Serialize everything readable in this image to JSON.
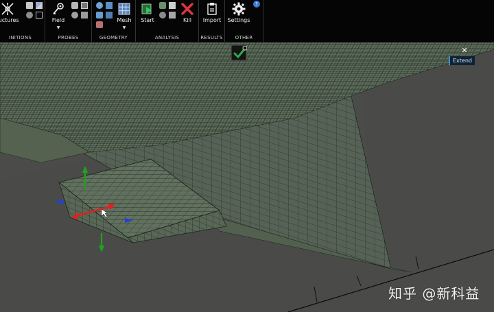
{
  "ribbon": {
    "groups": [
      {
        "label": "INITIONS",
        "buttons": [
          {
            "label": "ructures",
            "icon": "structures-icon"
          }
        ]
      },
      {
        "label": "PROBES",
        "buttons": [
          {
            "label": "Field",
            "icon": "field-probe-icon",
            "has_menu": true
          }
        ]
      },
      {
        "label": "GEOMETRY",
        "buttons": [
          {
            "label": "Mesh",
            "icon": "mesh-icon",
            "has_menu": true
          }
        ]
      },
      {
        "label": "ANALYSIS",
        "buttons": [
          {
            "label": "Start",
            "icon": "start-icon"
          },
          {
            "label": "Kill",
            "icon": "kill-icon"
          }
        ]
      },
      {
        "label": "RESULTS",
        "buttons": [
          {
            "label": "Import",
            "icon": "import-icon"
          }
        ]
      },
      {
        "label": "OTHER",
        "buttons": [
          {
            "label": "Settings",
            "icon": "gear-icon"
          }
        ]
      }
    ],
    "caret": "▼",
    "help_icon": "help-icon"
  },
  "viewport": {
    "extend_label": "Extend",
    "close_glyph": "✕",
    "check_icon": "check-icon",
    "watermark": "知乎 @新科益"
  },
  "colors": {
    "ribbon_bg": "#050505",
    "viewport_bg": "#4b4c4a",
    "mesh_fill": "#5d6a5b",
    "mesh_line": "#1f2a1e",
    "axis_x": "#e02020",
    "axis_y": "#1ea31e",
    "axis_z": "#1f3fe0",
    "accent_blue": "#3b90d6",
    "check_green": "#2ea84a",
    "kill_red": "#e0343c"
  }
}
